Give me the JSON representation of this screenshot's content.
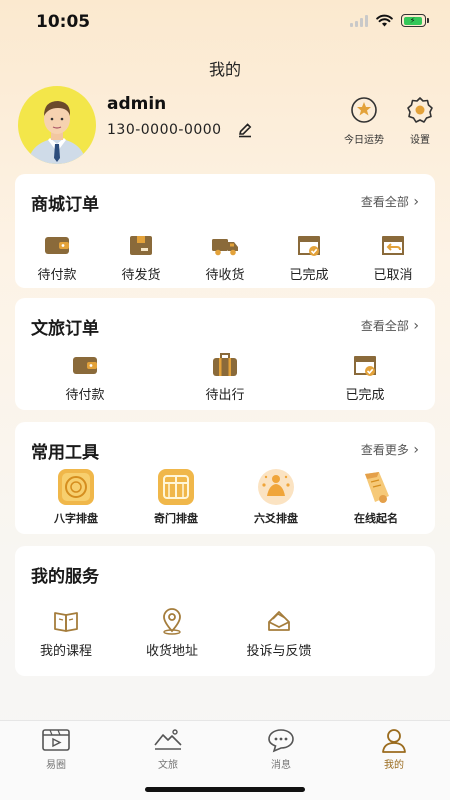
{
  "status_bar": {
    "time": "10:05",
    "battery_level": 0.9
  },
  "header": {
    "title": "我的"
  },
  "profile": {
    "username": "admin",
    "phone": "130-0000-0000"
  },
  "top_actions": [
    {
      "label": "今日运势",
      "icon": "fortune-icon"
    },
    {
      "label": "设置",
      "icon": "gear-icon"
    }
  ],
  "mall_orders": {
    "title": "商城订单",
    "more": "查看全部",
    "items": [
      {
        "label": "待付款",
        "icon": "wallet-icon"
      },
      {
        "label": "待发货",
        "icon": "package-icon"
      },
      {
        "label": "待收货",
        "icon": "truck-icon"
      },
      {
        "label": "已完成",
        "icon": "box-check-icon"
      },
      {
        "label": "已取消",
        "icon": "return-box-icon"
      }
    ]
  },
  "travel_orders": {
    "title": "文旅订单",
    "more": "查看全部",
    "items": [
      {
        "label": "待付款",
        "icon": "wallet-icon"
      },
      {
        "label": "待出行",
        "icon": "suitcase-icon"
      },
      {
        "label": "已完成",
        "icon": "box-check-icon"
      }
    ]
  },
  "tools": {
    "title": "常用工具",
    "more": "查看更多",
    "items": [
      {
        "label": "八字排盘",
        "icon": "bazi-chart-icon"
      },
      {
        "label": "奇门排盘",
        "icon": "qimen-chart-icon"
      },
      {
        "label": "六爻排盘",
        "icon": "liuyao-chart-icon"
      },
      {
        "label": "在线起名",
        "icon": "scroll-icon"
      }
    ]
  },
  "services": {
    "title": "我的服务",
    "items": [
      {
        "label": "我的课程",
        "icon": "book-icon"
      },
      {
        "label": "收货地址",
        "icon": "location-pin-icon"
      },
      {
        "label": "投诉与反馈",
        "icon": "feedback-icon"
      }
    ]
  },
  "bottom_nav": [
    {
      "label": "易圈",
      "icon": "video-icon",
      "active": false
    },
    {
      "label": "文旅",
      "icon": "landscape-icon",
      "active": false
    },
    {
      "label": "消息",
      "icon": "chat-bubble-icon",
      "active": false
    },
    {
      "label": "我的",
      "icon": "user-icon",
      "active": true
    }
  ],
  "colors": {
    "accent": "#9a6b1e",
    "icon_dark": "#8a6a3a",
    "battery": "#34c759"
  }
}
